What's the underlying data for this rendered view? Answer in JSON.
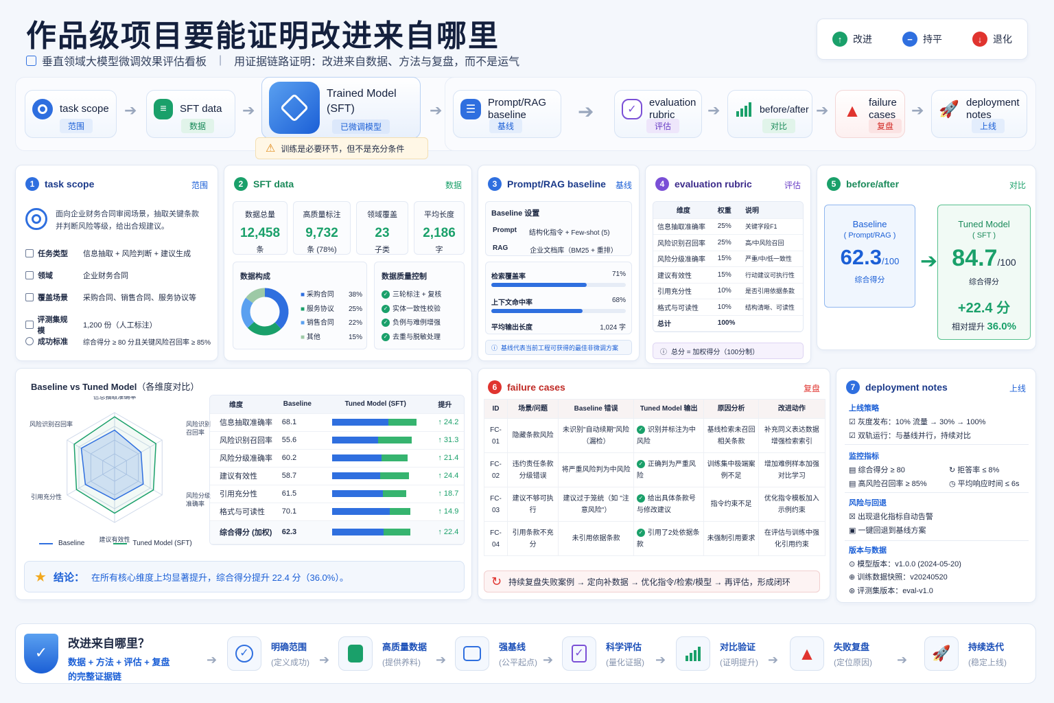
{
  "header": {
    "title": "作品级项目要能证明改进来自哪里",
    "subtitle": "垂直领域大模型微调效果评估看板",
    "subtitle2": "用证据链路证明：改进来自数据、方法与复盘，而不是运气"
  },
  "legend": [
    {
      "label": "改进",
      "color": "#1aa06a"
    },
    {
      "label": "持平",
      "color": "#2f6fdf"
    },
    {
      "label": "退化",
      "color": "#e0342f"
    }
  ],
  "flow": [
    {
      "name": "task scope",
      "tag": "范围"
    },
    {
      "name": "SFT data",
      "tag": "数据"
    },
    {
      "name": "Trained Model (SFT)",
      "tag": "已微调模型",
      "warn": "训练是必要环节，但不是充分条件"
    },
    {
      "name": "Prompt/RAG baseline",
      "tag": "基线"
    },
    {
      "name": "evaluation rubric",
      "tag": "评估"
    },
    {
      "name": "before/after",
      "tag": "对比"
    },
    {
      "name": "failure cases",
      "tag": "复盘"
    },
    {
      "name": "deployment notes",
      "tag": "上线"
    }
  ],
  "scope": {
    "title": "task scope",
    "tag": "范围",
    "desc1": "面向企业财务合同审阅场景，抽取关键条款",
    "desc2": "并判断风险等级，给出合规建议。",
    "rows": [
      {
        "k": "任务类型",
        "v": "信息抽取 + 风险判断 + 建议生成"
      },
      {
        "k": "领域",
        "v": "企业财务合同"
      },
      {
        "k": "覆盖场景",
        "v": "采购合同、销售合同、服务协议等"
      },
      {
        "k": "评测集规模",
        "v": "1,200 份（人工标注）"
      },
      {
        "k": "成功标准",
        "v": "综合得分 ≥ 80 分且关键风险召回率 ≥ 85%"
      }
    ]
  },
  "sft": {
    "title": "SFT data",
    "tag": "数据",
    "stats": [
      {
        "l": "数据总量",
        "v": "12,458",
        "u": "条"
      },
      {
        "l": "高质量标注",
        "v": "9,732",
        "u": "条 (78%)"
      },
      {
        "l": "领域覆盖",
        "v": "23",
        "u": "子类"
      },
      {
        "l": "平均长度",
        "v": "2,186",
        "u": "字"
      }
    ],
    "comp_title": "数据构成",
    "comp": [
      {
        "n": "采购合同",
        "p": "38%",
        "v": 38,
        "c": "#2f6fdf"
      },
      {
        "n": "服务协议",
        "p": "25%",
        "v": 25,
        "c": "#1aa06a"
      },
      {
        "n": "销售合同",
        "p": "22%",
        "v": 22,
        "c": "#5aa0f0"
      },
      {
        "n": "其他",
        "p": "15%",
        "v": 15,
        "c": "#9dc9a6"
      }
    ],
    "qc_title": "数据质量控制",
    "qc": [
      "三轮标注 + 复核",
      "实体一致性校验",
      "负例与难例增强",
      "去重与脱敏处理"
    ]
  },
  "rag": {
    "title": "Prompt/RAG baseline",
    "tag": "基线",
    "setting": "Baseline 设置",
    "rows": [
      {
        "k": "Prompt",
        "v": "结构化指令 + Few-shot (5)"
      },
      {
        "k": "RAG",
        "v": "企业文档库（BM25 + 重排）"
      }
    ],
    "metrics": [
      {
        "k": "检索覆盖率",
        "v": "71%",
        "p": 71
      },
      {
        "k": "上下文命中率",
        "v": "68%",
        "p": 68
      }
    ],
    "len_k": "平均输出长度",
    "len_v": "1,024 字",
    "note": "基线代表当前工程可获得的最佳非微调方案"
  },
  "rubric": {
    "title": "evaluation rubric",
    "tag": "评估",
    "heads": [
      "维度",
      "权重",
      "说明"
    ],
    "rows": [
      [
        "信息抽取准确率",
        "25%",
        "关键字段F1"
      ],
      [
        "风险识别召回率",
        "25%",
        "高/中风险召回"
      ],
      [
        "风险分级准确率",
        "15%",
        "严重/中/低一致性"
      ],
      [
        "建议有效性",
        "15%",
        "行动建议可执行性"
      ],
      [
        "引用充分性",
        "10%",
        "是否引用依据条款"
      ],
      [
        "格式与可读性",
        "10%",
        "结构清晰、可读性"
      ]
    ],
    "total": [
      "总计",
      "100%",
      ""
    ],
    "note": "总分 = 加权得分（100分制）"
  },
  "ba": {
    "title": "before/after",
    "tag": "对比",
    "b_name": "Baseline",
    "b_sub": "( Prompt/RAG )",
    "b_score": "62.3",
    "t_name": "Tuned Model",
    "t_sub": "( SFT )",
    "t_score": "84.7",
    "unit": "/100",
    "label": "综合得分",
    "delta": "+22.4 分",
    "rel_label": "相对提升",
    "rel": "36.0%"
  },
  "cmp": {
    "title": "Baseline vs Tuned Model",
    "title_sub": "（各维度对比）",
    "heads": [
      "维度",
      "Baseline",
      "Tuned Model (SFT)",
      "提升"
    ],
    "rows": [
      {
        "n": "信息抽取准确率",
        "b": "68.1",
        "t": 92.3,
        "d": "24.2"
      },
      {
        "n": "风险识别召回率",
        "b": "55.6",
        "t": 86.9,
        "d": "31.3"
      },
      {
        "n": "风险分级准确率",
        "b": "60.2",
        "t": 81.6,
        "d": "21.4"
      },
      {
        "n": "建议有效性",
        "b": "58.7",
        "t": 83.1,
        "d": "24.4"
      },
      {
        "n": "引用充分性",
        "b": "61.5",
        "t": 80.2,
        "d": "18.7"
      },
      {
        "n": "格式与可读性",
        "b": "70.1",
        "t": 85.0,
        "d": "14.9"
      }
    ],
    "total": {
      "n": "综合得分 (加权)",
      "b": "62.3",
      "t": 84.7,
      "d": "22.4"
    },
    "radar_labels": [
      "信息抽取准确率",
      "风险识别召回率",
      "风险分级准确率",
      "建议有效性",
      "引用充分性",
      "风险识别召回率"
    ],
    "legend_b": "Baseline",
    "legend_t": "Tuned Model (SFT)",
    "conclusion_k": "结论：",
    "conclusion": "在所有核心维度上均显著提升，综合得分提升 22.4 分（36.0%）。"
  },
  "chart_data": {
    "type": "radar",
    "axes": [
      "信息抽取准确率",
      "风险识别召回率",
      "风险分级准确率",
      "建议有效性",
      "引用充分性",
      "风险识别召回率"
    ],
    "range": [
      0,
      100
    ],
    "series": [
      {
        "name": "Baseline",
        "values": [
          68.1,
          55.6,
          60.2,
          58.7,
          61.5,
          70.1
        ]
      },
      {
        "name": "Tuned Model (SFT)",
        "values": [
          92.3,
          86.9,
          81.6,
          83.1,
          80.2,
          85.0
        ]
      }
    ]
  },
  "fail": {
    "title": "failure cases",
    "tag": "复盘",
    "heads": [
      "ID",
      "场景/问题",
      "Baseline 错误",
      "Tuned Model 输出",
      "原因分析",
      "改进动作"
    ],
    "rows": [
      [
        "FC-01",
        "隐藏条款风险",
        "未识别\"自动续期\"风险（漏检）",
        "识别并标注为中风险",
        "基线检索未召回相关条款",
        "补充同义表达数据增强检索索引"
      ],
      [
        "FC-02",
        "违约责任条款分级错误",
        "将严重风险判为中风险",
        "正确判为严重风险",
        "训练集中极端案例不足",
        "增加难例样本加强对比学习"
      ],
      [
        "FC-03",
        "建议不够可执行",
        "建议过于笼统（如 \"注意风险\"）",
        "给出具体条款号与修改建议",
        "指令约束不足",
        "优化指令模板加入示例约束"
      ],
      [
        "FC-04",
        "引用条款不充分",
        "未引用依据条款",
        "引用了2处依据条款",
        "未强制引用要求",
        "在评估与训练中强化引用约束"
      ]
    ],
    "loop": "持续复盘失败案例 → 定向补数据 → 优化指令/检索/模型 → 再评估，形成闭环"
  },
  "dep": {
    "title": "deployment notes",
    "tag": "上线",
    "s1": "上线策略",
    "s1_items": [
      "灰度发布：10% 流量 → 30% → 100%",
      "双轨运行：与基线并行，持续对比"
    ],
    "s2": "监控指标",
    "s2_items": [
      "综合得分 ≥ 80",
      "拒答率 ≤ 8%",
      "高风险召回率 ≥ 85%",
      "平均响应时间 ≤ 6s"
    ],
    "s3": "风险与回退",
    "s3_items": [
      "出现退化指标自动告警",
      "一键回退到基线方案"
    ],
    "s4": "版本与数据",
    "s4_items": [
      "模型版本：v1.0.0 (2024-05-20)",
      "训练数据快照：v20240520",
      "评测集版本：eval-v1.0"
    ]
  },
  "chain": {
    "t1": "改进来自哪里？",
    "t2": "数据 + 方法 + 评估 + 复盘",
    "t3": "的完整证据链",
    "steps": [
      {
        "a": "明确范围",
        "b": "(定义成功)"
      },
      {
        "a": "高质量数据",
        "b": "(提供养料)"
      },
      {
        "a": "强基线",
        "b": "(公平起点)"
      },
      {
        "a": "科学评估",
        "b": "(量化证据)"
      },
      {
        "a": "对比验证",
        "b": "(证明提升)"
      },
      {
        "a": "失败复盘",
        "b": "(定位原因)"
      },
      {
        "a": "持续迭代",
        "b": "(稳定上线)"
      }
    ]
  }
}
